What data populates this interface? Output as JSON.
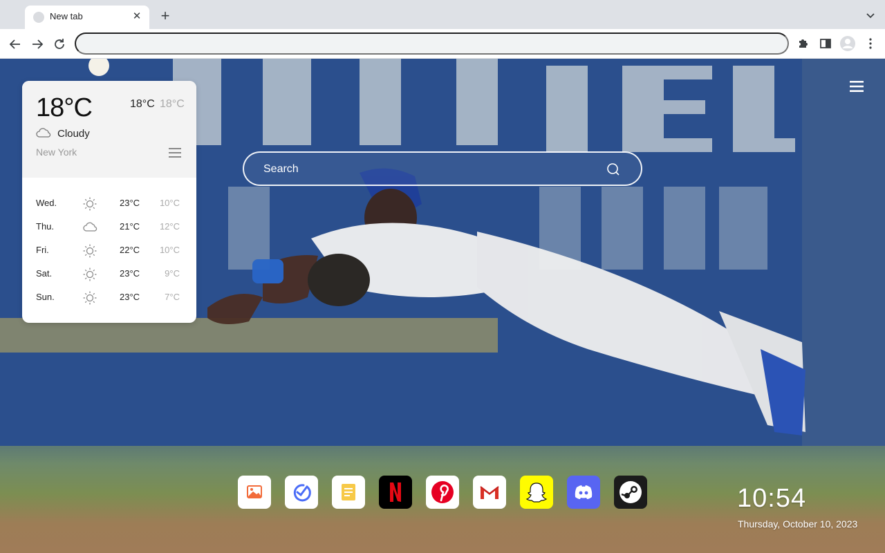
{
  "browser": {
    "tab_title": "New tab",
    "tab_close": "✕",
    "new_tab": "+",
    "omnibox_placeholder": ""
  },
  "search": {
    "placeholder": "Search"
  },
  "weather": {
    "current_temp": "18°C",
    "high": "18°C",
    "low": "18°C",
    "condition": "Cloudy",
    "condition_icon": "cloud-icon",
    "city": "New York",
    "forecast": [
      {
        "day": "Wed.",
        "icon": "sun-icon",
        "high": "23°C",
        "low": "10°C"
      },
      {
        "day": "Thu.",
        "icon": "cloud-icon",
        "high": "21°C",
        "low": "12°C"
      },
      {
        "day": "Fri.",
        "icon": "sun-icon",
        "high": "22°C",
        "low": "10°C"
      },
      {
        "day": "Sat.",
        "icon": "sun-icon",
        "high": "23°C",
        "low": "9°C"
      },
      {
        "day": "Sun.",
        "icon": "sun-icon",
        "high": "23°C",
        "low": "7°C"
      }
    ]
  },
  "dock": {
    "apps": [
      {
        "name": "photos",
        "icon": "photos-icon",
        "bg": "#ffffff"
      },
      {
        "name": "tasks",
        "icon": "check-circle-icon",
        "bg": "#ffffff"
      },
      {
        "name": "notes",
        "icon": "notes-icon",
        "bg": "#ffffff"
      },
      {
        "name": "netflix",
        "icon": "netflix-icon",
        "bg": "#000000"
      },
      {
        "name": "pinterest",
        "icon": "pinterest-icon",
        "bg": "#ffffff"
      },
      {
        "name": "gmail",
        "icon": "gmail-icon",
        "bg": "#ffffff"
      },
      {
        "name": "snapchat",
        "icon": "snapchat-icon",
        "bg": "#fffc00"
      },
      {
        "name": "discord",
        "icon": "discord-icon",
        "bg": "#5865f2"
      },
      {
        "name": "steam",
        "icon": "steam-icon",
        "bg": "#1b1b1b"
      }
    ]
  },
  "clock": {
    "time": "10:54",
    "date": "Thursday, October 10, 2023"
  },
  "colors": {
    "chrome_bg": "#dee1e6",
    "wallpaper_blue": "#2c4f8c"
  }
}
